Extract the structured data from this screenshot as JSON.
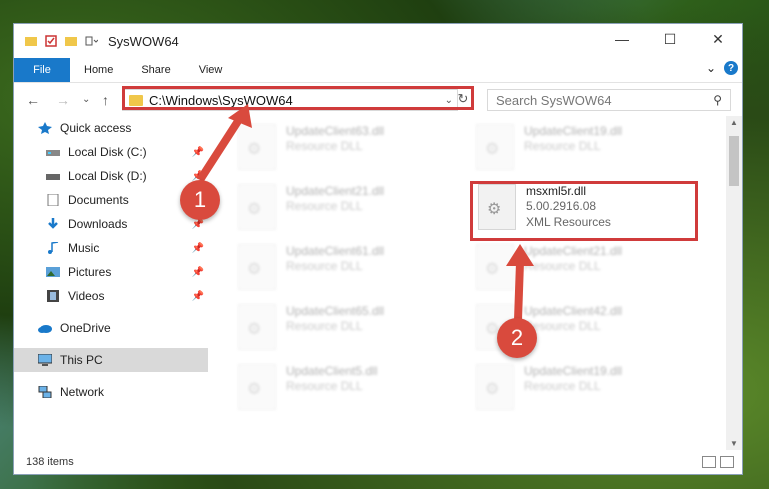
{
  "window": {
    "title": "SysWOW64",
    "controls": {
      "minimize": "—",
      "maximize": "☐",
      "close": "✕"
    }
  },
  "ribbon": {
    "file": "File",
    "tabs": [
      "Home",
      "Share",
      "View"
    ],
    "collapse": "⌄",
    "help": "?"
  },
  "nav": {
    "back": "←",
    "forward": "→",
    "recent": "⌄",
    "up": "↑",
    "address": "C:\\Windows\\SysWOW64",
    "address_chevron": "⌄",
    "refresh": "↻",
    "search_placeholder": "Search SysWOW64",
    "search_icon": "⚲"
  },
  "sidebar": {
    "items": [
      {
        "label": "Quick access",
        "icon": "star-icon",
        "pinned": false
      },
      {
        "label": "Local Disk (C:)",
        "icon": "drive-icon",
        "pinned": true
      },
      {
        "label": "Local Disk (D:)",
        "icon": "drive-icon",
        "pinned": true
      },
      {
        "label": "Documents",
        "icon": "document-icon",
        "pinned": true
      },
      {
        "label": "Downloads",
        "icon": "download-icon",
        "pinned": true
      },
      {
        "label": "Music",
        "icon": "music-icon",
        "pinned": true
      },
      {
        "label": "Pictures",
        "icon": "pictures-icon",
        "pinned": true
      },
      {
        "label": "Videos",
        "icon": "videos-icon",
        "pinned": true
      },
      {
        "label": "OneDrive",
        "icon": "cloud-icon",
        "pinned": false
      },
      {
        "label": "This PC",
        "icon": "pc-icon",
        "pinned": false,
        "selected": true
      },
      {
        "label": "Network",
        "icon": "network-icon",
        "pinned": false
      }
    ],
    "pin_glyph": "📌"
  },
  "files": {
    "highlighted": {
      "name": "msxml5r.dll",
      "version": "5.00.2916.08",
      "description": "XML Resources"
    },
    "blurred": [
      {
        "name": "UpdateClient63.dll",
        "desc": "Resource DLL"
      },
      {
        "name": "UpdateClient19.dll",
        "desc": "Resource DLL"
      },
      {
        "name": "UpdateClient21.dll",
        "desc": "Resource DLL"
      },
      {
        "name": "UpdateClient61.dll",
        "desc": "Resource DLL"
      },
      {
        "name": "UpdateClient21.dll",
        "desc": "Resource DLL"
      },
      {
        "name": "UpdateClient65.dll",
        "desc": "Resource DLL"
      },
      {
        "name": "UpdateClient42.dll",
        "desc": "Resource DLL"
      },
      {
        "name": "UpdateClient5.dll",
        "desc": "Resource DLL"
      },
      {
        "name": "UpdateClient19.dll",
        "desc": "Resource DLL"
      }
    ]
  },
  "status": {
    "count": "138 items"
  },
  "callouts": {
    "one": "1",
    "two": "2"
  },
  "colors": {
    "accent": "#1979ca",
    "highlight": "#d03b3b",
    "callout": "#d94a3d"
  }
}
